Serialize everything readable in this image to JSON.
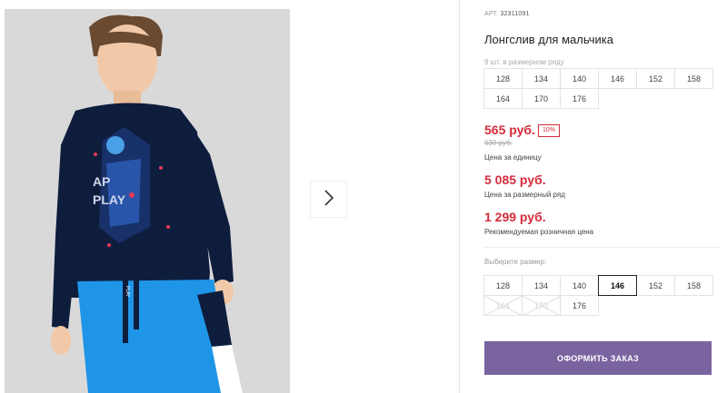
{
  "product": {
    "sku_label": "АРТ.",
    "sku": "32311091",
    "title": "Лонгслив для мальчика",
    "row_note": "9 шт. в размерном ряду",
    "print_text_1": "AP",
    "print_text_2": "PLAY",
    "string_text": "PLAY"
  },
  "size_row": [
    "128",
    "134",
    "140",
    "146",
    "152",
    "158",
    "164",
    "170",
    "176"
  ],
  "pricing": {
    "price": "565 руб.",
    "discount": "10%",
    "old_price": "630 руб.",
    "unit_caption": "Цена за единицу",
    "row_price": "5 085 руб.",
    "row_caption": "Цена за размерный ряд",
    "retail_price": "1 299 руб.",
    "retail_caption": "Рекомендуемая розничная цена"
  },
  "size_select": {
    "label": "Выберите размер:",
    "sizes": [
      {
        "label": "128",
        "state": "available"
      },
      {
        "label": "134",
        "state": "available"
      },
      {
        "label": "140",
        "state": "available"
      },
      {
        "label": "146",
        "state": "selected"
      },
      {
        "label": "152",
        "state": "available"
      },
      {
        "label": "158",
        "state": "available"
      },
      {
        "label": "164",
        "state": "disabled"
      },
      {
        "label": "170",
        "state": "disabled"
      },
      {
        "label": "176",
        "state": "available"
      }
    ]
  },
  "actions": {
    "order_label": "ОФОРМИТЬ ЗАКАЗ",
    "next_icon": "chevron-right-icon"
  },
  "colors": {
    "accent": "#7a64a0",
    "price_red": "#d62b3a",
    "shirt_navy": "#0f1d3d",
    "pants_blue": "#1f95e8"
  }
}
